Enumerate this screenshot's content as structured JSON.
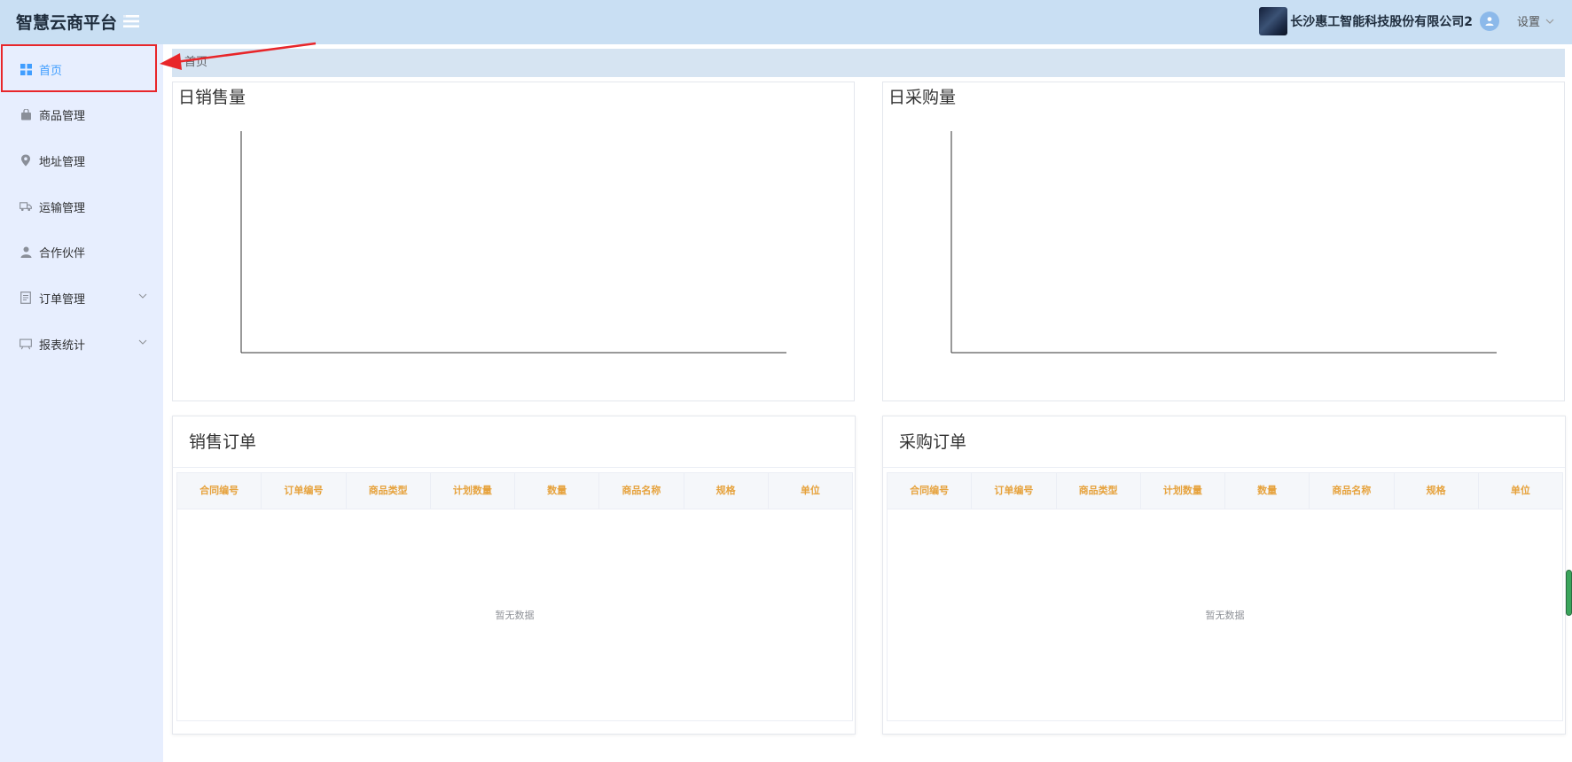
{
  "header": {
    "app_title": "智慧云商平台",
    "company_name": "长沙惠工智能科技股份有限公司2",
    "settings_label": "设置"
  },
  "sidebar": {
    "items": [
      {
        "label": "首页",
        "icon": "dashboard-icon",
        "active": true
      },
      {
        "label": "商品管理",
        "icon": "shopping-bag-icon"
      },
      {
        "label": "地址管理",
        "icon": "location-icon"
      },
      {
        "label": "运输管理",
        "icon": "truck-icon"
      },
      {
        "label": "合作伙伴",
        "icon": "user-icon"
      },
      {
        "label": "订单管理",
        "icon": "document-icon",
        "expandable": true
      },
      {
        "label": "报表统计",
        "icon": "board-icon",
        "expandable": true
      }
    ]
  },
  "breadcrumb": {
    "current": "首页"
  },
  "charts": {
    "daily_sales": {
      "title": "日销售量"
    },
    "daily_purchase": {
      "title": "日采购量"
    }
  },
  "chart_data": [
    {
      "type": "line",
      "title": "日销售量",
      "series": [],
      "x": []
    },
    {
      "type": "line",
      "title": "日采购量",
      "series": [],
      "x": []
    }
  ],
  "sales_orders": {
    "title": "销售订单",
    "columns": [
      "合同编号",
      "订单编号",
      "商品类型",
      "计划数量",
      "数量",
      "商品名称",
      "规格",
      "单位"
    ],
    "rows": [],
    "empty_text": "暂无数据"
  },
  "purchase_orders": {
    "title": "采购订单",
    "columns": [
      "合同编号",
      "订单编号",
      "商品类型",
      "计划数量",
      "数量",
      "商品名称",
      "规格",
      "单位"
    ],
    "rows": [],
    "empty_text": "暂无数据"
  },
  "colors": {
    "header_bg": "#c9dff3",
    "sidebar_bg": "#e7eefe",
    "active_color": "#409eff",
    "annotation_red": "#e8262a",
    "column_header_text": "#e6a23c"
  }
}
